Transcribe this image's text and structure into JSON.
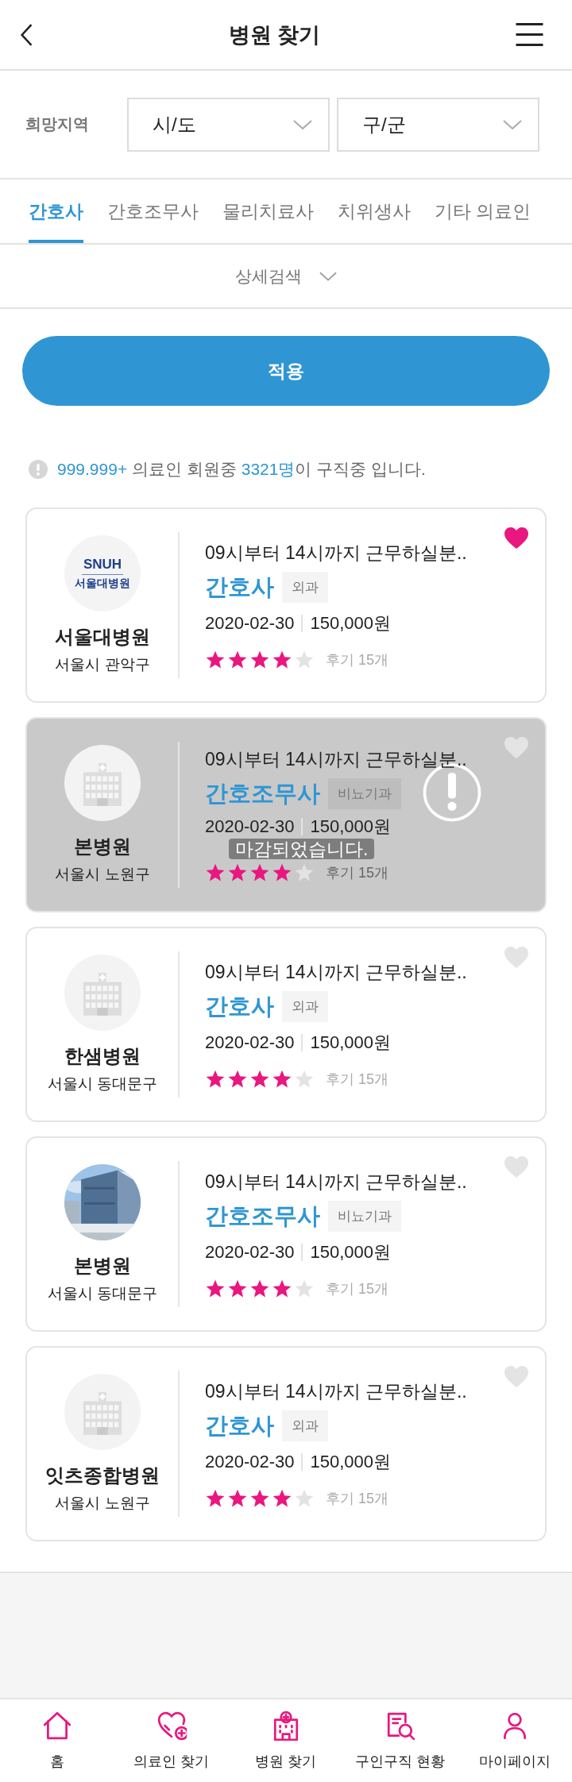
{
  "header": {
    "title": "병원 찾기"
  },
  "region": {
    "label": "희망지역",
    "selects": [
      {
        "placeholder": "시/도"
      },
      {
        "placeholder": "구/군"
      }
    ]
  },
  "tabs": [
    {
      "label": "간호사",
      "selected": true
    },
    {
      "label": "간호조무사",
      "selected": false
    },
    {
      "label": "물리치료사",
      "selected": false
    },
    {
      "label": "치위생사",
      "selected": false
    },
    {
      "label": "기타 의료인",
      "selected": false
    }
  ],
  "detail_search": {
    "label": "상세검색"
  },
  "apply_button": {
    "label": "적용"
  },
  "notice": {
    "parts": [
      {
        "text": "999.999+",
        "highlight": true
      },
      {
        "text": " 의료인 회원중 ",
        "highlight": false
      },
      {
        "text": "3321명",
        "highlight": true
      },
      {
        "text": "이 구직중 입니다.",
        "highlight": false
      }
    ]
  },
  "jobs": [
    {
      "logo": {
        "kind": "logo",
        "lines": [
          "SNUH",
          "서울대병원"
        ]
      },
      "hospital": "서울대병원",
      "location": "서울시 관악구",
      "title": "09시부터 14시까지 근무하실분..",
      "role": "간호사",
      "department": "외과",
      "date": "2020-02-30",
      "pay": "150,000원",
      "stars": 4,
      "reviews": "후기 15개",
      "favorite": true,
      "closed": false
    },
    {
      "logo": {
        "kind": "placeholder"
      },
      "hospital": "본병원",
      "location": "서울시 노원구",
      "title": "09시부터 14시까지 근무하실분..",
      "role": "간호조무사",
      "department": "비뇨기과",
      "date": "2020-02-30",
      "pay": "150,000원",
      "stars": 4,
      "reviews": "후기 15개",
      "favorite": false,
      "closed": true,
      "closed_label": "마감되었습니다."
    },
    {
      "logo": {
        "kind": "placeholder"
      },
      "hospital": "한샘병원",
      "location": "서울시 동대문구",
      "title": "09시부터 14시까지 근무하실분..",
      "role": "간호사",
      "department": "외과",
      "date": "2020-02-30",
      "pay": "150,000원",
      "stars": 4,
      "reviews": "후기 15개",
      "favorite": false,
      "closed": false
    },
    {
      "hospital": "본병원",
      "location": "서울시 동대문구",
      "title": "09시부터 14시까지 근무하실분..",
      "role": "간호조무사",
      "department": "비뇨기과",
      "date": "2020-02-30",
      "pay": "150,000원",
      "stars": 4,
      "reviews": "후기 15개",
      "favorite": false,
      "closed": false
    },
    {
      "logo": {
        "kind": "placeholder"
      },
      "hospital": "잇츠종합병원",
      "location": "서울시 노원구",
      "title": "09시부터 14시까지 근무하실분..",
      "role": "간호사",
      "department": "외과",
      "date": "2020-02-30",
      "pay": "150,000원",
      "stars": 4,
      "reviews": "후기 15개",
      "favorite": false,
      "closed": false
    }
  ],
  "bottom_nav": [
    {
      "label": "홈"
    },
    {
      "label": "의료인 찾기"
    },
    {
      "label": "병원 찾기"
    },
    {
      "label": "구인구직 현황"
    },
    {
      "label": "마이페이지"
    }
  ]
}
